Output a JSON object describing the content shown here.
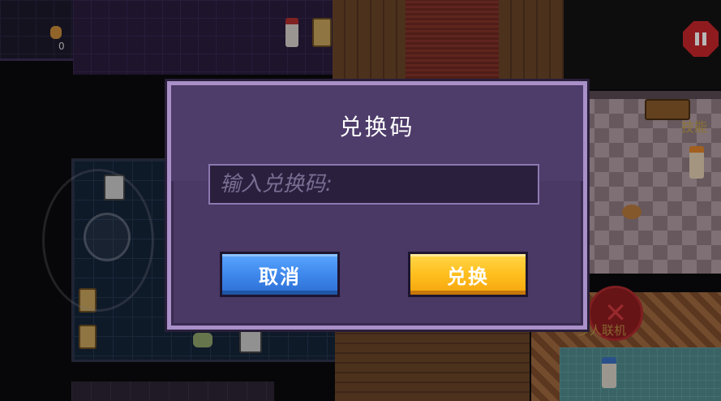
{
  "hud": {
    "skill_label": "技能",
    "multiplayer_label": "多人联机",
    "coin_count": "0",
    "pause_icon": "pause-icon",
    "close_icon": "close-x-icon"
  },
  "dialog": {
    "title": "兑换码",
    "input_placeholder": "输入兑换码:",
    "input_value": "",
    "cancel_label": "取消",
    "confirm_label": "兑换"
  },
  "colors": {
    "dialog_bg": "#4a3964",
    "dialog_border": "#a990c9",
    "cancel_button": "#3f88ec",
    "confirm_button": "#ffbf1e",
    "pause_button": "#c8262b"
  }
}
